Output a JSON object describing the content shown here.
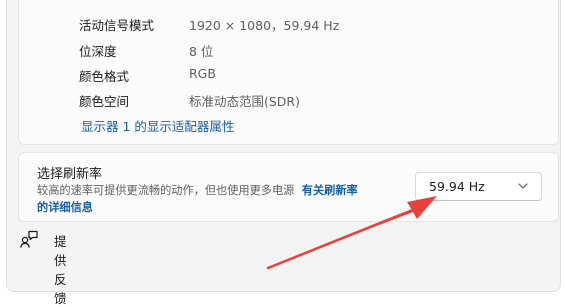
{
  "display_info": {
    "rows": [
      {
        "label": "活动信号模式",
        "value": "1920 × 1080，59.94 Hz"
      },
      {
        "label": "位深度",
        "value": "8 位"
      },
      {
        "label": "颜色格式",
        "value": "RGB"
      },
      {
        "label": "颜色空间",
        "value": "标准动态范围(SDR)"
      }
    ],
    "adapter_link": "显示器 1 的显示适配器属性"
  },
  "refresh_rate": {
    "title": "选择刷新率",
    "description": "较高的速率可提供更流畅的动作，但也使用更多电源",
    "more_link_line1": "有关刷新率",
    "more_link_line2": "的详细信息",
    "selected": "59.94 Hz",
    "chevron_icon": "chevron-down-icon"
  },
  "feedback": {
    "label": "提供反馈",
    "icon": "feedback-icon"
  },
  "colors": {
    "accent_link": "#1a5fa8",
    "annotation_arrow": "#e8403a"
  }
}
